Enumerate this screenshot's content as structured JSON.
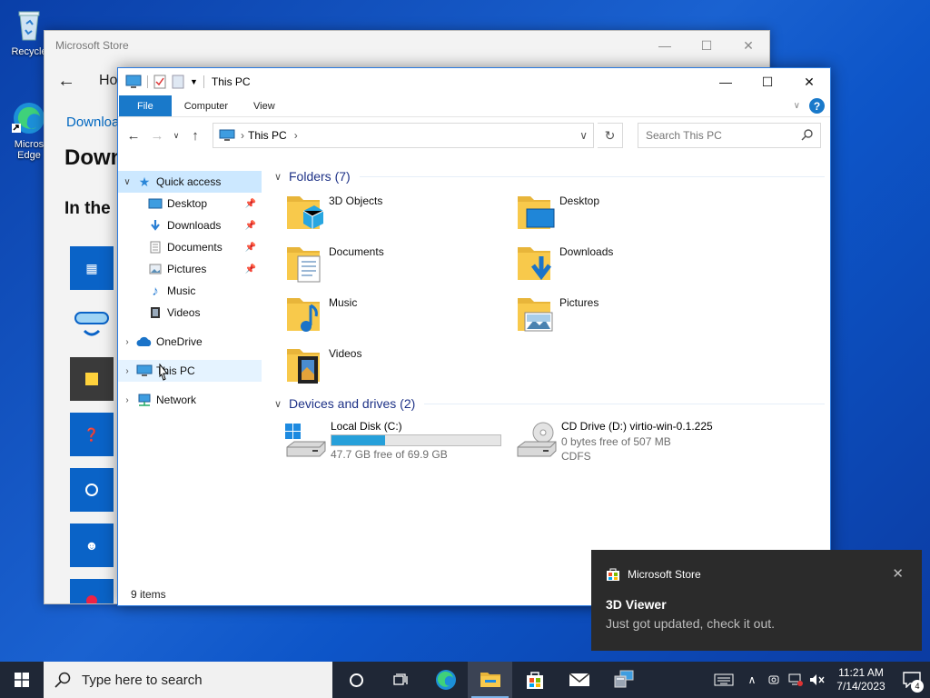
{
  "desktop": {
    "icons": [
      {
        "label": "Recycle",
        "icon": "recycle-bin-icon"
      },
      {
        "label": "Micros Edge",
        "icon": "edge-icon"
      }
    ]
  },
  "store": {
    "title": "Microsoft Store",
    "home_label": "Ho",
    "downloads_link": "Downloa",
    "heading": "Down",
    "subheading": "In the"
  },
  "explorer": {
    "title": "This PC",
    "ribbon": {
      "tabs": [
        "File",
        "Computer",
        "View"
      ]
    },
    "address": {
      "crumb": "This PC"
    },
    "search": {
      "placeholder": "Search This PC"
    },
    "nav": {
      "quick_access": "Quick access",
      "quick_items": [
        "Desktop",
        "Downloads",
        "Documents",
        "Pictures",
        "Music",
        "Videos"
      ],
      "onedrive": "OneDrive",
      "this_pc": "This PC",
      "network": "Network"
    },
    "folders_header": "Folders (7)",
    "folders": [
      "3D Objects",
      "Desktop",
      "Documents",
      "Downloads",
      "Music",
      "Pictures",
      "Videos"
    ],
    "drives_header": "Devices and drives (2)",
    "drives": [
      {
        "name": "Local Disk (C:)",
        "free": "47.7 GB free of 69.9 GB",
        "used_fraction": 0.318
      },
      {
        "name": "CD Drive (D:) virtio-win-0.1.225",
        "free": "0 bytes free of 507 MB",
        "fs": "CDFS"
      }
    ],
    "status": "9 items"
  },
  "toast": {
    "app": "Microsoft Store",
    "title": "3D Viewer",
    "message": "Just got updated, check it out."
  },
  "taskbar": {
    "search_placeholder": "Type here to search",
    "time": "11:21 AM",
    "date": "7/14/2023",
    "notification_count": "4"
  },
  "colors": {
    "accent": "#1979ca",
    "selection": "#cce8ff",
    "folder": "#f8c94b",
    "taskbar": "#1f2736"
  }
}
